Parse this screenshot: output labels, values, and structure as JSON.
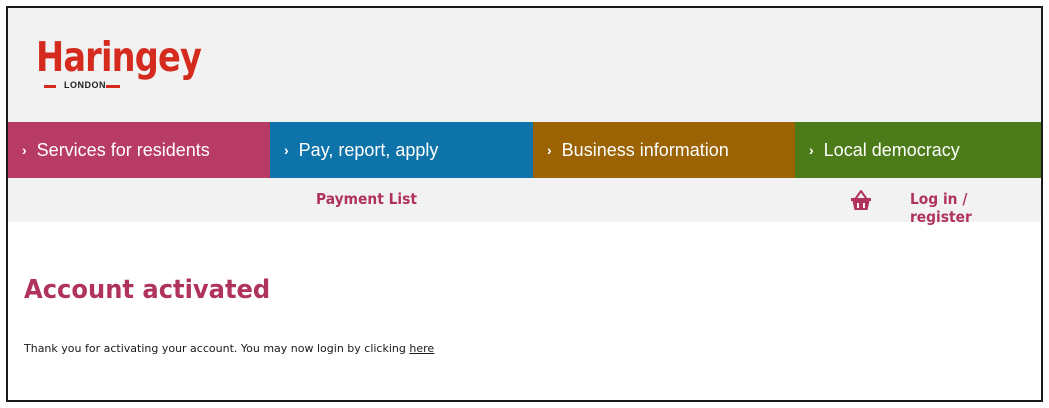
{
  "logo": {
    "name": "Haringey",
    "subtitle": "LONDON",
    "color": "#d52b1e"
  },
  "nav": {
    "items": [
      {
        "label": "Services for residents",
        "color": "#b83b66"
      },
      {
        "label": "Pay, report, apply",
        "color": "#0e73a8"
      },
      {
        "label": "Business information",
        "color": "#9b6303"
      },
      {
        "label": "Local democracy",
        "color": "#4c7b19"
      }
    ],
    "chevron": "›"
  },
  "subbar": {
    "payment_list": "Payment List",
    "basket_icon": "basket-icon",
    "login": "Log in / register",
    "accent": "#b0325f"
  },
  "main": {
    "title": "Account activated",
    "message_prefix": "Thank you for activating your account. You may now login by clicking ",
    "link_text": "here"
  }
}
